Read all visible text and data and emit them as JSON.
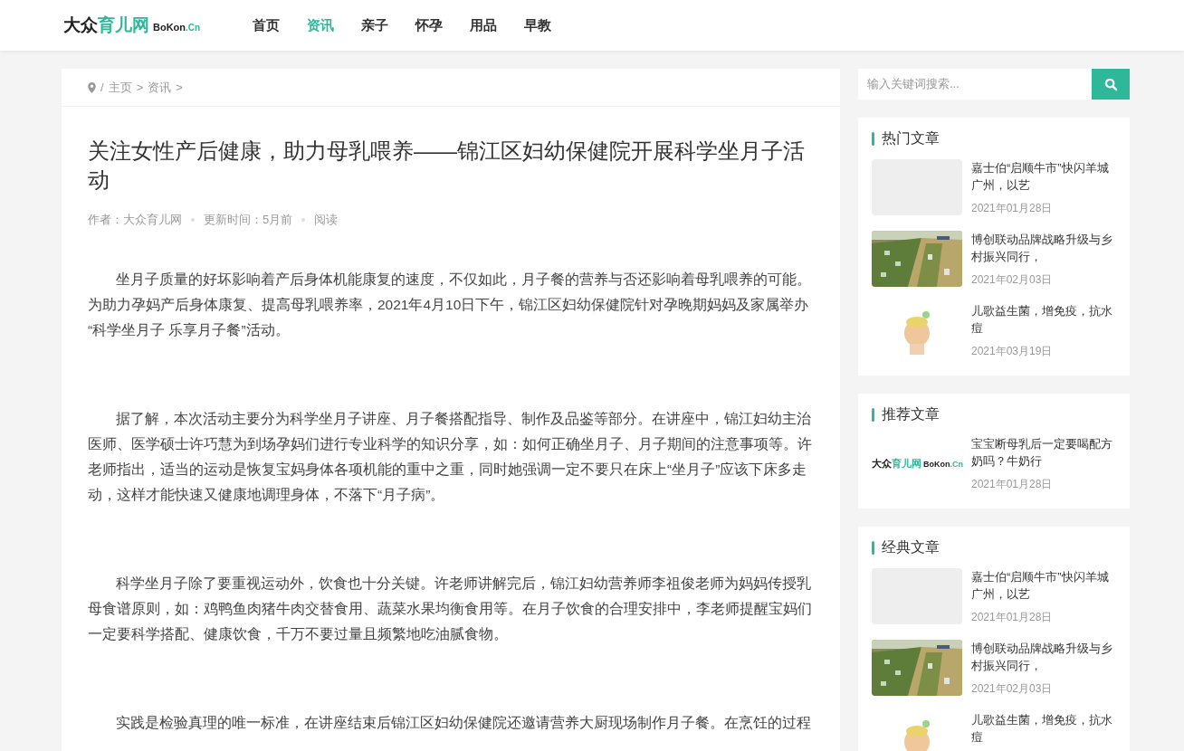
{
  "header": {
    "logo": {
      "dark": "大众",
      "accent": "育儿网",
      "latin": "BoKon",
      "suffix": ".Cn"
    },
    "nav": [
      {
        "label": "首页",
        "selected": false
      },
      {
        "label": "资讯",
        "selected": true
      },
      {
        "label": "亲子",
        "selected": false
      },
      {
        "label": "怀孕",
        "selected": false
      },
      {
        "label": "用品",
        "selected": false
      },
      {
        "label": "早教",
        "selected": false
      }
    ]
  },
  "breadcrumb": {
    "separator": "/",
    "items": [
      "主页",
      "资讯"
    ],
    "arrow": ">"
  },
  "article": {
    "title": "关注女性产后健康，助力母乳喂养——锦江区妇幼保健院开展科学坐月子活动",
    "meta": [
      "作者：大众育儿网",
      "更新时间：5月前",
      "阅读"
    ],
    "paragraphs": [
      {
        "text": "坐月子质量的好坏影响着产后身体机能康复的速度，不仅如此，月子餐的营养与否还影响着母乳喂养的可能。为助力孕妈产后身体康复、提高母乳喂养率，2021年4月10日下午，锦江区妇幼保健院针对孕晚期妈妈及家属举办 “科学坐月子 乐享月子餐”活动。"
      },
      {
        "text": "据了解，本次活动主要分为科学坐月子讲座、月子餐搭配指导、制作及品鉴等部分。在讲座中，锦江妇幼主治医师、医学硕士许巧慧为到场孕妈们进行专业科学的知识分享，如：如何正确坐月子、月子期间的注意事项等。许老师指出，适当的运动是恢复宝妈身体各项机能的重中之重，同时她强调一定不要只在床上“坐月子”应该下床多走动，这样才能快速又健康地调理身体，不落下“月子病”。"
      },
      {
        "text": "科学坐月子除了要重视运动外，饮食也十分关键。许老师讲解完后，锦江妇幼营养师李祖俊老师为妈妈传授乳母食谱原则，如：鸡鸭鱼肉猪牛肉交替食用、蔬菜水果均衡食用等。在月子饮食的合理安排中，李老师提醒宝妈们一定要科学搭配、健康饮食，千万不要过量且频繁地吃油腻食物。"
      },
      {
        "text": "实践是检验真理的唯一标准，在讲座结束后锦江区妇幼保健院还邀请营养大厨现场制作月子餐。在烹饪的过程"
      }
    ]
  },
  "sidebar": {
    "search": {
      "placeholder": "输入关键词搜索..."
    },
    "sections": [
      {
        "title": "热门文章",
        "items": [
          {
            "title": "嘉士伯“启顺牛市”快闪羊城广州，以艺",
            "date": "2021年01月28日",
            "thumb": {
              "kind": "blank"
            }
          },
          {
            "title": "博创联动品牌战略升级与乡村振兴同行，",
            "date": "2021年02月03日"
          },
          {
            "title": "儿歌益生菌，增免疫，抗水痘",
            "date": "2021年03月19日",
            "thumb": {
              "kind": "cartoon"
            }
          }
        ]
      },
      {
        "title": "推荐文章",
        "items": [
          {
            "title": "宝宝断母乳后一定要喝配方奶吗？牛奶行",
            "date": "2021年01月28日",
            "thumb": {
              "kind": "logo",
              "dark": "大众",
              "accent": "育儿网",
              "latin": "BoKon",
              "suffix": ".Cn"
            }
          }
        ]
      },
      {
        "title": "经典文章",
        "items": [
          {
            "title": "嘉士伯“启顺牛市”快闪羊城广州，以艺",
            "date": "2021年01月28日",
            "thumb": {
              "kind": "blank"
            }
          },
          {
            "title": "博创联动品牌战略升级与乡村振兴同行，",
            "date": "2021年02月03日"
          },
          {
            "title": "儿歌益生菌，增免疫，抗水痘",
            "thumb": {
              "kind": "cartoon"
            }
          }
        ]
      }
    ]
  }
}
